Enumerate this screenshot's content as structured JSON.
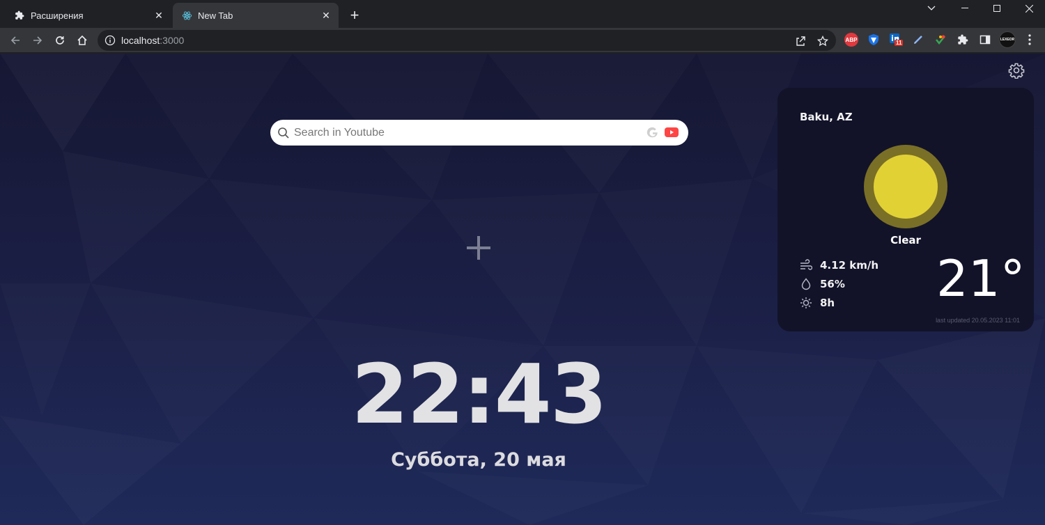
{
  "browser": {
    "tabs": [
      {
        "label": "Расширения",
        "active": false,
        "icon": "puzzle-icon"
      },
      {
        "label": "New Tab",
        "active": true,
        "icon": "react-icon"
      }
    ],
    "url_host": "localhost",
    "url_port": ":3000",
    "extensions": [
      {
        "name": "adblock-plus-icon",
        "label": "ABP",
        "color": "#e0393e"
      },
      {
        "name": "shield-extension-icon",
        "label": "",
        "color": "#1a73e8"
      },
      {
        "name": "linkedin-extension-icon",
        "label": "11",
        "color": "#0a66c2"
      },
      {
        "name": "pencil-extension-icon",
        "label": "",
        "color": "#8ab4f8"
      },
      {
        "name": "color-picker-extension-icon",
        "label": "",
        "color": "#34a853"
      },
      {
        "name": "extensions-puzzle-icon",
        "label": "",
        "color": "#e8eaed"
      },
      {
        "name": "side-panel-icon",
        "label": "",
        "color": "#e8eaed"
      },
      {
        "name": "profile-avatar",
        "label": "LEXEOR",
        "color": "#111"
      }
    ]
  },
  "search": {
    "placeholder": "Search in Youtube"
  },
  "clock": {
    "time": "22:43",
    "date": "Суббота, 20 мая"
  },
  "weather": {
    "city": "Baku, AZ",
    "condition": "Clear",
    "wind": "4.12 km/h",
    "humidity": "56%",
    "daylight": "8h",
    "temperature": "21°",
    "updated": "last updated 20.05.2023 11:01"
  },
  "colors": {
    "sun": "#e2d135",
    "sun_ring": "#7a6f26",
    "youtube": "#ff4444"
  }
}
